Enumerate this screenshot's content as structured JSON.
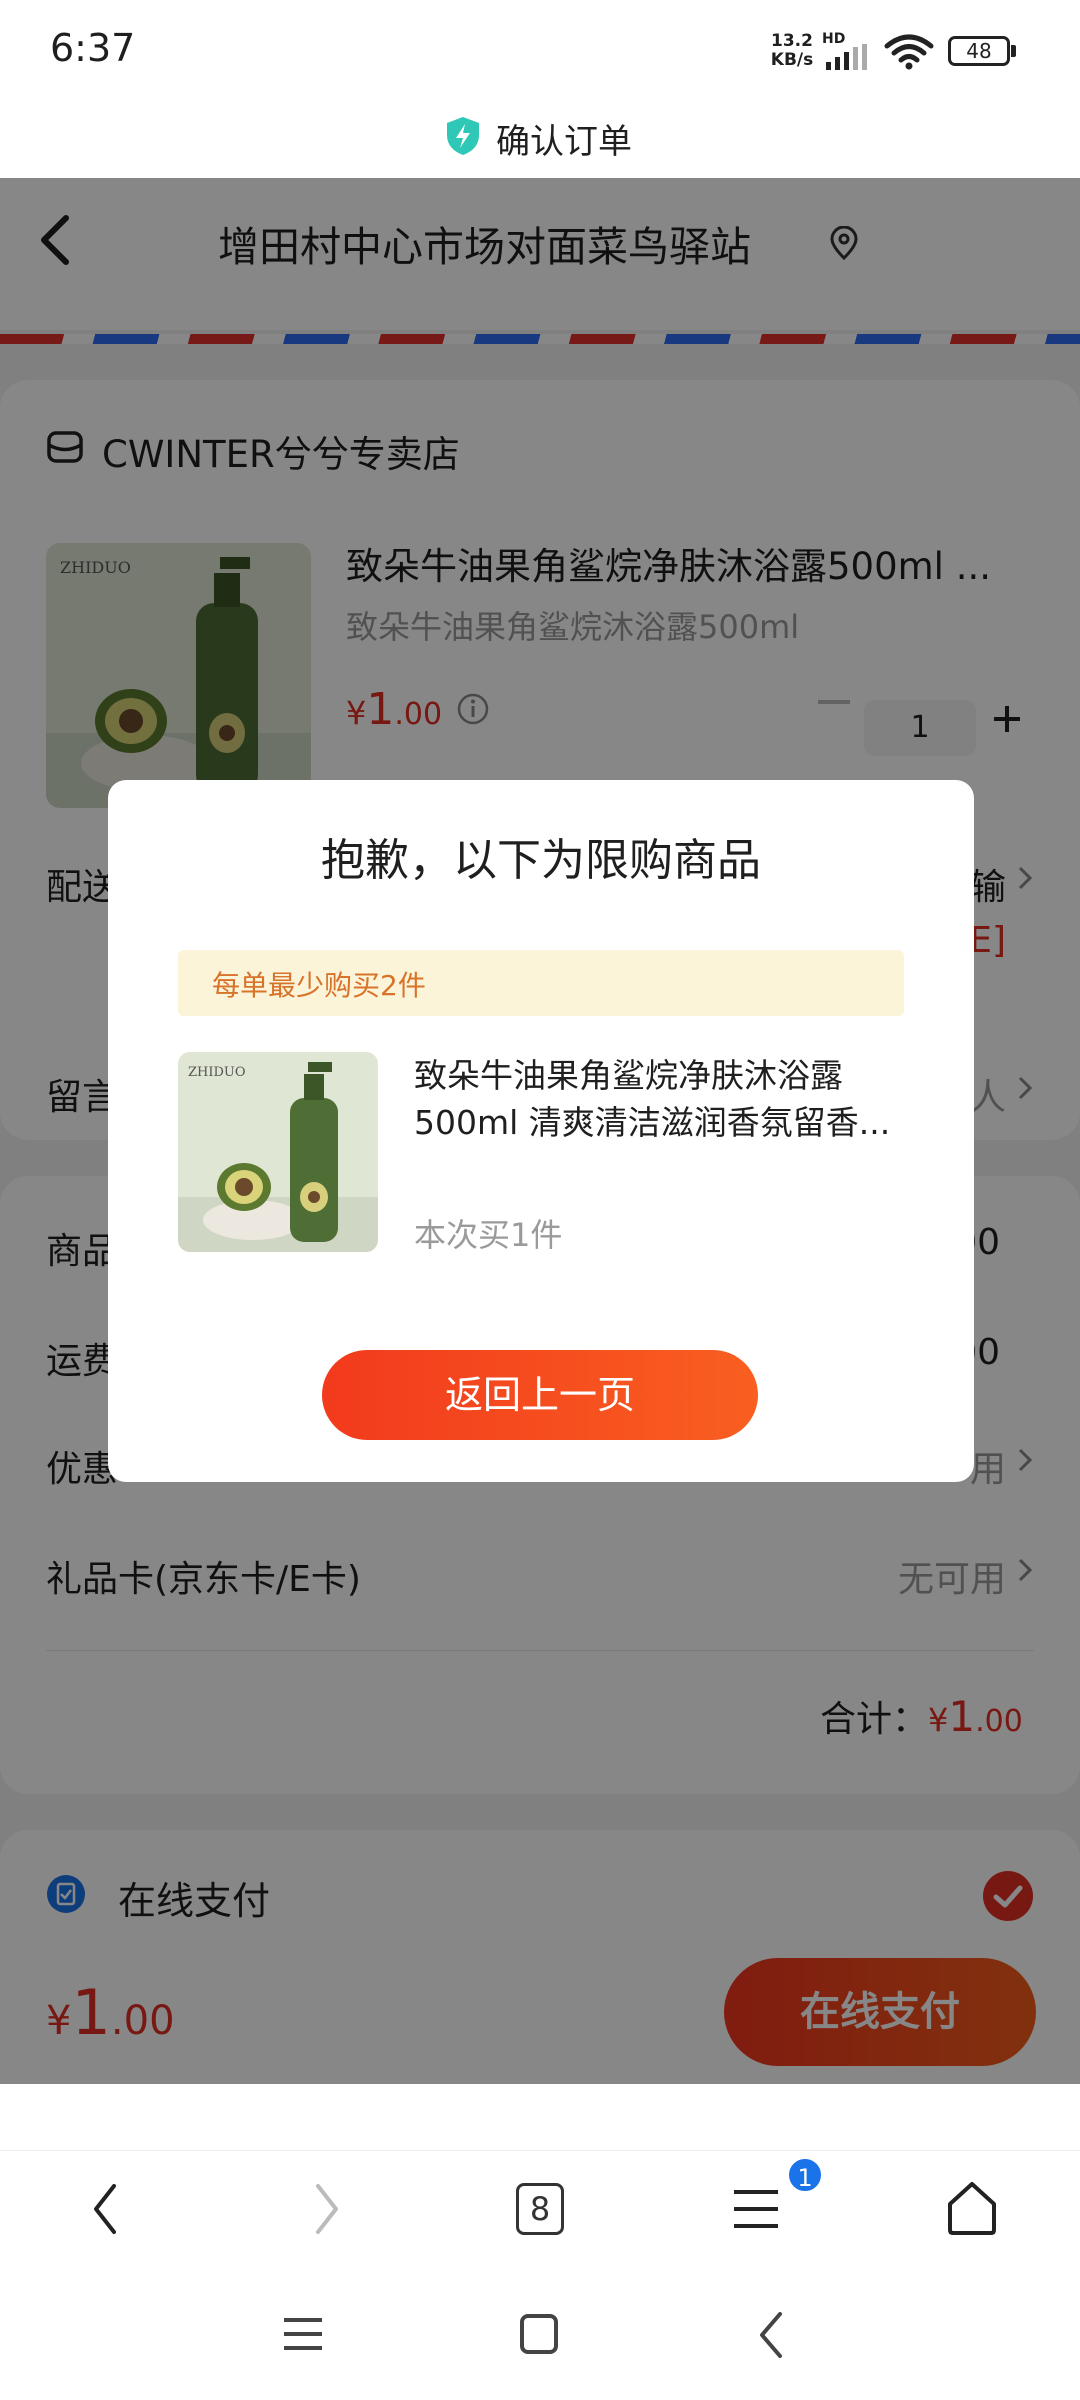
{
  "status_bar": {
    "time": "6:37",
    "net_speed_value": "13.2",
    "net_speed_unit": "KB/s",
    "hd_label": "HD",
    "battery_level": "48"
  },
  "header": {
    "title": "确认订单"
  },
  "address": {
    "text": "增田村中心市场对面菜鸟驿站"
  },
  "store": {
    "name": "CWINTER兮兮专卖店"
  },
  "product": {
    "thumb_brand": "ZHIDUO",
    "title": "致朵牛油果角鲨烷净肤沐浴露500ml ...",
    "spec": "致朵牛油果角鲨烷沐浴露500ml",
    "currency": "¥",
    "price_int": "1",
    "price_dec": ".00",
    "quantity": "1"
  },
  "rows": {
    "delivery_label": "配送",
    "delivery_value": "输",
    "delivery_tag": "E]",
    "note_label": "留言",
    "note_value": "人",
    "goods_label": "商品",
    "goods_value": "00",
    "shipping_label": "运费",
    "shipping_value": "00",
    "coupon_label": "优惠",
    "coupon_value": "用",
    "giftcard_label": "礼品卡(京东卡/E卡)",
    "giftcard_value": "无可用",
    "total_label": "合计：",
    "total_currency": "¥",
    "total_int": "1",
    "total_dec": ".00"
  },
  "payment": {
    "method_label": "在线支付"
  },
  "bottom_bar": {
    "currency": "¥",
    "total_int": "1",
    "total_dec": ".00",
    "pay_button_label": "在线支付"
  },
  "modal": {
    "title": "抱歉，以下为限购商品",
    "limit_text": "每单最少购买2件",
    "thumb_brand": "ZHIDUO",
    "product_title": "致朵牛油果角鲨烷净肤沐浴露500ml 清爽清洁滋润香氛留香...",
    "qty_note": "本次买1件",
    "return_button_label": "返回上一页"
  },
  "browser_nav": {
    "tab_count": "8",
    "menu_badge": "1"
  },
  "colors": {
    "accent_red": "#e02e24",
    "button_gradient_start": "#f23a1d",
    "button_gradient_end": "#f95f20",
    "limit_banner_bg": "#fbf4d8",
    "limit_text": "#d8732a",
    "badge_blue": "#1a73e8"
  },
  "icons": [
    "shield-icon",
    "back-arrow-icon",
    "location-icon",
    "store-icon",
    "info-icon",
    "plus-icon",
    "chevron-right-icon",
    "payment-icon",
    "check-icon",
    "back-icon",
    "forward-icon",
    "tabs-icon",
    "menu-icon",
    "home-icon"
  ]
}
